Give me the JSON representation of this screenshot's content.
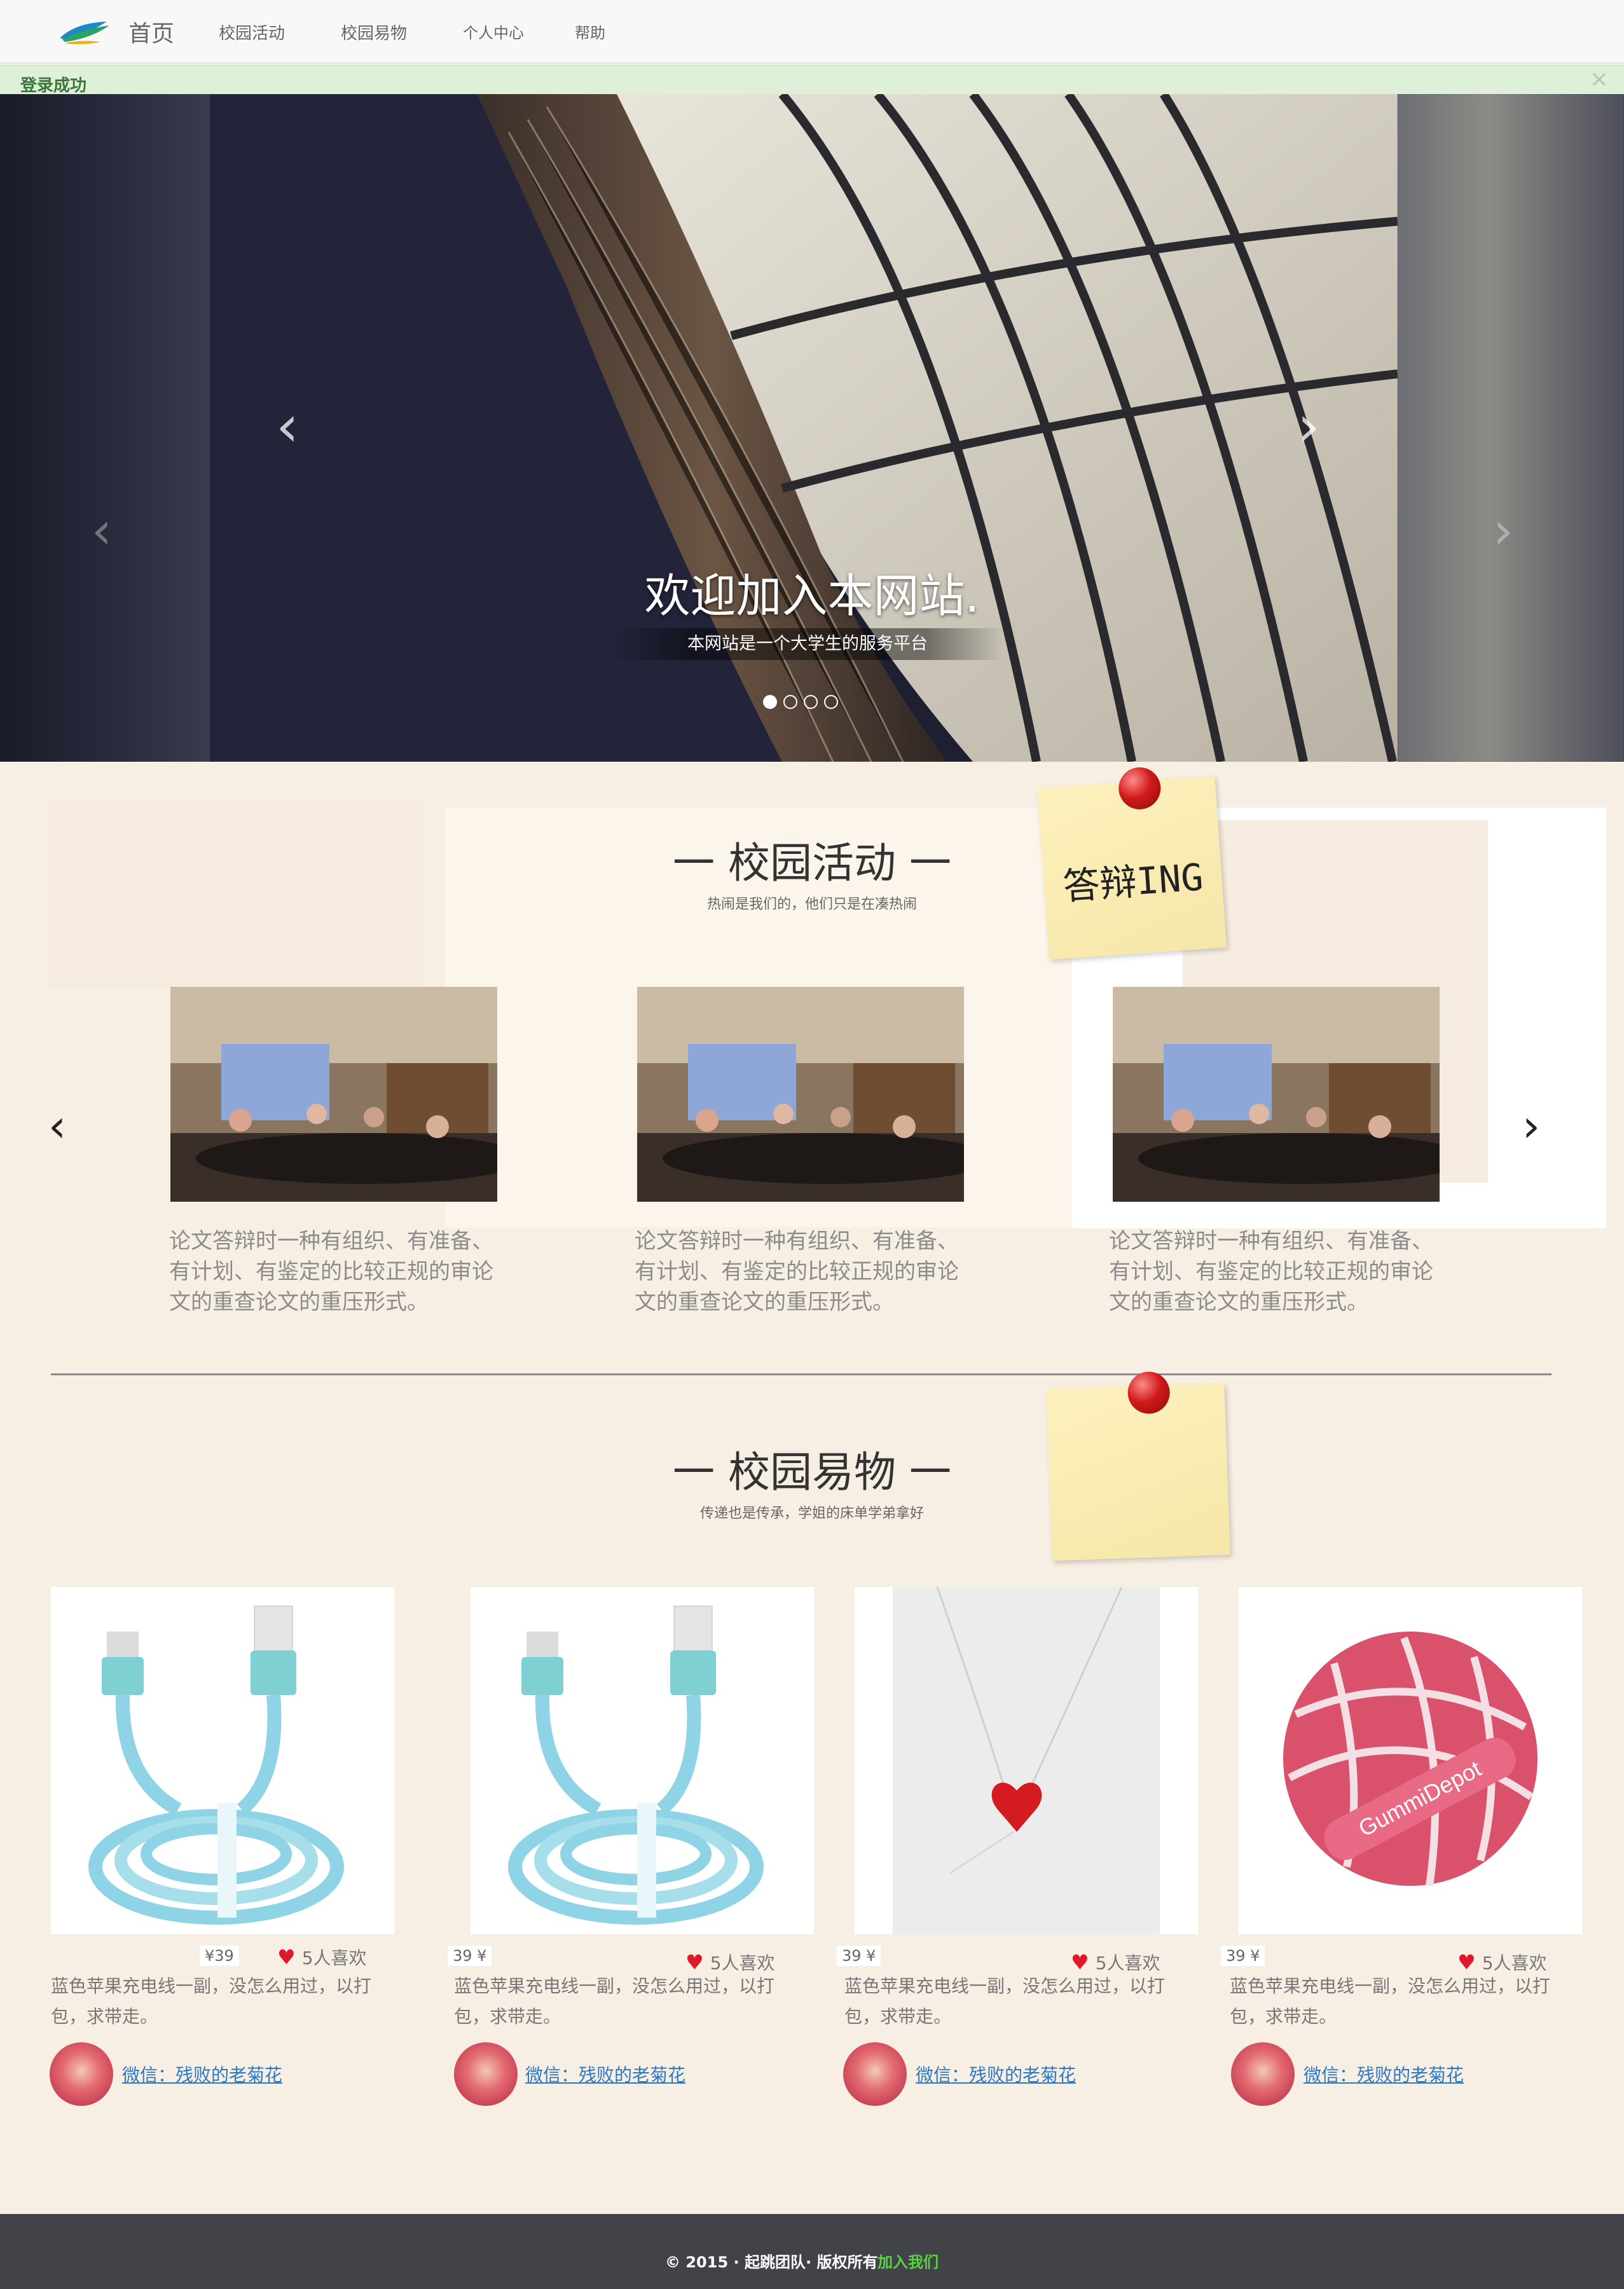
{
  "nav": {
    "brand": "首页",
    "items": [
      "校园活动",
      "校园易物",
      "个人中心",
      "帮助"
    ]
  },
  "alert": {
    "message": "登录成功",
    "close": "×"
  },
  "carousel": {
    "title": "欢迎加入本网站.",
    "subtitle": "本网站是一个大学生的服务平台",
    "active_slide": 1,
    "slide_count": 4
  },
  "activities": {
    "title": "一 校园活动 一",
    "subtitle": "热闹是我们的，他们只是在凑热闹",
    "note": "答辩ING",
    "items": [
      {
        "text": "论文答辩时一种有组织、有准备、有计划、有鉴定的比较正规的审论文的重查论文的重压形式。"
      },
      {
        "text": "论文答辩时一种有组织、有准备、有计划、有鉴定的比较正规的审论文的重查论文的重压形式。"
      },
      {
        "text": "论文答辩时一种有组织、有准备、有计划、有鉴定的比较正规的审论文的重查论文的重压形式。"
      }
    ]
  },
  "goods": {
    "title": "一 校园易物 一",
    "subtitle": "传递也是传承，学姐的床单学弟拿好",
    "items": [
      {
        "price": "¥39",
        "likes": "5人喜欢",
        "desc": "蓝色苹果充电线一副，没怎么用过，以打包，求带走。",
        "contact": "微信：残败的老菊花",
        "kind": "cable"
      },
      {
        "price": "39 ¥",
        "likes": "5人喜欢",
        "desc": "蓝色苹果充电线一副，没怎么用过，以打包，求带走。",
        "contact": "微信：残败的老菊花",
        "kind": "cable"
      },
      {
        "price": "39 ¥",
        "likes": "5人喜欢",
        "desc": "蓝色苹果充电线一副，没怎么用过，以打包，求带走。",
        "contact": "微信：残败的老菊花",
        "kind": "necklace"
      },
      {
        "price": "39 ¥",
        "likes": "5人喜欢",
        "desc": "蓝色苹果充电线一副，没怎么用过，以打包，求带走。",
        "contact": "微信：残败的老菊花",
        "kind": "ball",
        "ball_label": "GummiDepot"
      }
    ]
  },
  "footer": {
    "copyright": "© 2015 · 起跳团队· 版权所有",
    "join": "加入我们"
  }
}
